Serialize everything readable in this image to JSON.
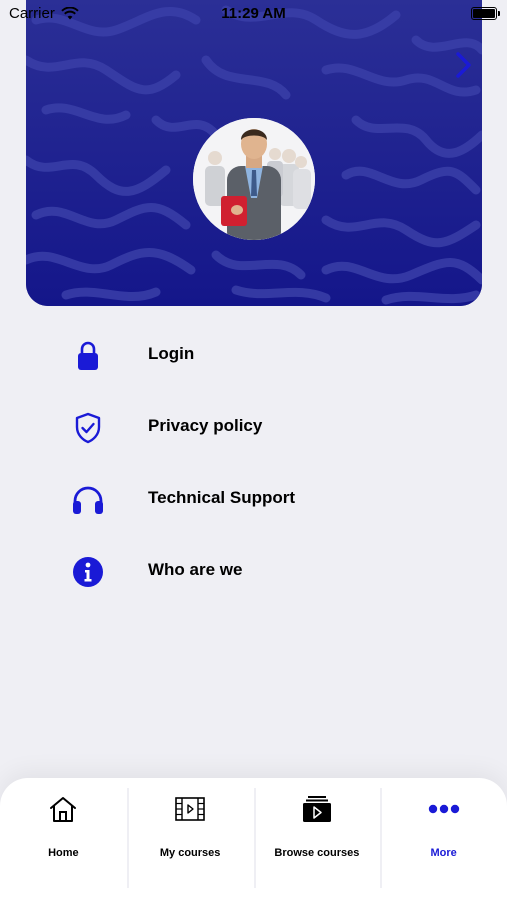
{
  "status_bar": {
    "carrier": "Carrier",
    "time": "11:29 AM",
    "icons": [
      "wifi-icon",
      "battery-icon"
    ]
  },
  "header": {
    "next_icon": "chevron-right-icon",
    "avatar_icon": "profile-photo"
  },
  "menu": {
    "items": [
      {
        "label": "Login",
        "icon": "lock-icon"
      },
      {
        "label": "Privacy policy",
        "icon": "shield-check-icon"
      },
      {
        "label": "Technical Support",
        "icon": "headphones-icon"
      },
      {
        "label": "Who are we",
        "icon": "info-icon"
      }
    ]
  },
  "tabbar": {
    "tabs": [
      {
        "label": "Home",
        "icon": "home-icon",
        "active": false
      },
      {
        "label": "My courses",
        "icon": "film-icon",
        "active": false
      },
      {
        "label": "Browse courses",
        "icon": "video-library-icon",
        "active": false
      },
      {
        "label": "More",
        "icon": "more-dots-icon",
        "active": true
      }
    ]
  },
  "colors": {
    "accent": "#1a1ad6",
    "banner": "#1b1d8c",
    "background": "#efeff4"
  }
}
